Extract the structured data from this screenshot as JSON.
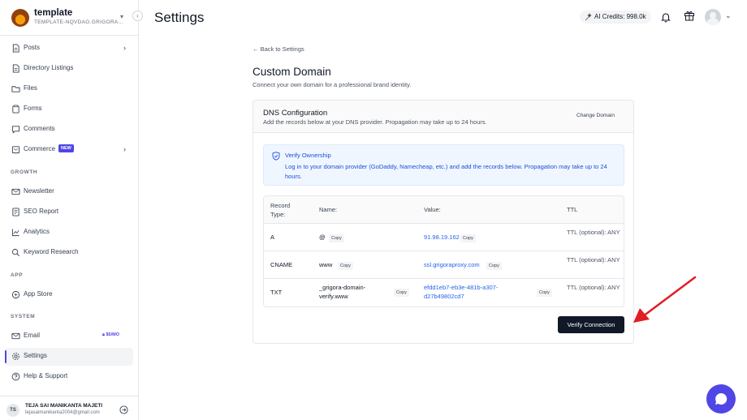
{
  "workspace": {
    "name": "template",
    "subdomain": "TEMPLATE-NQVDAG.GRIGORA..."
  },
  "header": {
    "title": "Settings",
    "credits": "AI Credits: 998.0k"
  },
  "sidebar": {
    "items": [
      {
        "label": "Posts",
        "icon": "document-icon"
      },
      {
        "label": "Directory Listings",
        "icon": "document-icon"
      },
      {
        "label": "Files",
        "icon": "folder-icon"
      },
      {
        "label": "Forms",
        "icon": "clipboard-icon"
      },
      {
        "label": "Comments",
        "icon": "chat-icon"
      },
      {
        "label": "Commerce",
        "icon": "cart-icon",
        "badge": "NEW"
      },
      {
        "label": "Newsletter",
        "icon": "mail-icon"
      },
      {
        "label": "SEO Report",
        "icon": "report-icon"
      },
      {
        "label": "Analytics",
        "icon": "chart-icon"
      },
      {
        "label": "Keyword Research",
        "icon": "search-icon"
      },
      {
        "label": "App Store",
        "icon": "grid-icon"
      },
      {
        "label": "Email",
        "icon": "mail-icon",
        "badge": "$5/MO"
      },
      {
        "label": "Settings",
        "icon": "gear-icon",
        "active": true
      },
      {
        "label": "Help & Support",
        "icon": "help-icon"
      }
    ],
    "sections": {
      "growth": "GROWTH",
      "app": "APP",
      "system": "SYSTEM"
    },
    "user": {
      "initials": "TS",
      "name": "TEJA SAI MANIKANTA MAJETI",
      "email": "tejasaimanikanta2004@gmail.com"
    }
  },
  "main": {
    "back_link": "← Back to Settings",
    "title": "Custom Domain",
    "subtitle": "Connect your own domain for a professional brand identity.",
    "dns": {
      "title": "DNS Configuration",
      "subtitle": "Add the records below at your DNS provider. Propagation may take up to 24 hours.",
      "change_domain": "Change Domain"
    },
    "verify": {
      "title": "Verify Ownership",
      "text": "Log in to your domain provider (GoDaddy, Namecheap, etc.) and add the records below. Propagation may take up to 24 hours."
    },
    "table": {
      "headers": {
        "type": "Record Type:",
        "name": "Name:",
        "value": "Value:",
        "ttl": "TTL"
      },
      "copy_label": "Copy",
      "rows": [
        {
          "type": "A",
          "name": "@",
          "value": "91.98.19.162",
          "ttl": "TTL (optional): ANY"
        },
        {
          "type": "CNAME",
          "name": "www",
          "value": "ssl.grigoraproxy.com",
          "ttl": "TTL (optional): ANY"
        },
        {
          "type": "TXT",
          "name": "_grigora-domain-verify.www",
          "value": "efdd1eb7-eb3e-481b-a307-d27b49802cd7",
          "ttl": "TTL (optional): ANY"
        }
      ]
    },
    "verify_button": "Verify Connection"
  },
  "colors": {
    "accent": "#4f46e5",
    "link": "#2563eb",
    "annotation_arrow": "#e11d26"
  }
}
